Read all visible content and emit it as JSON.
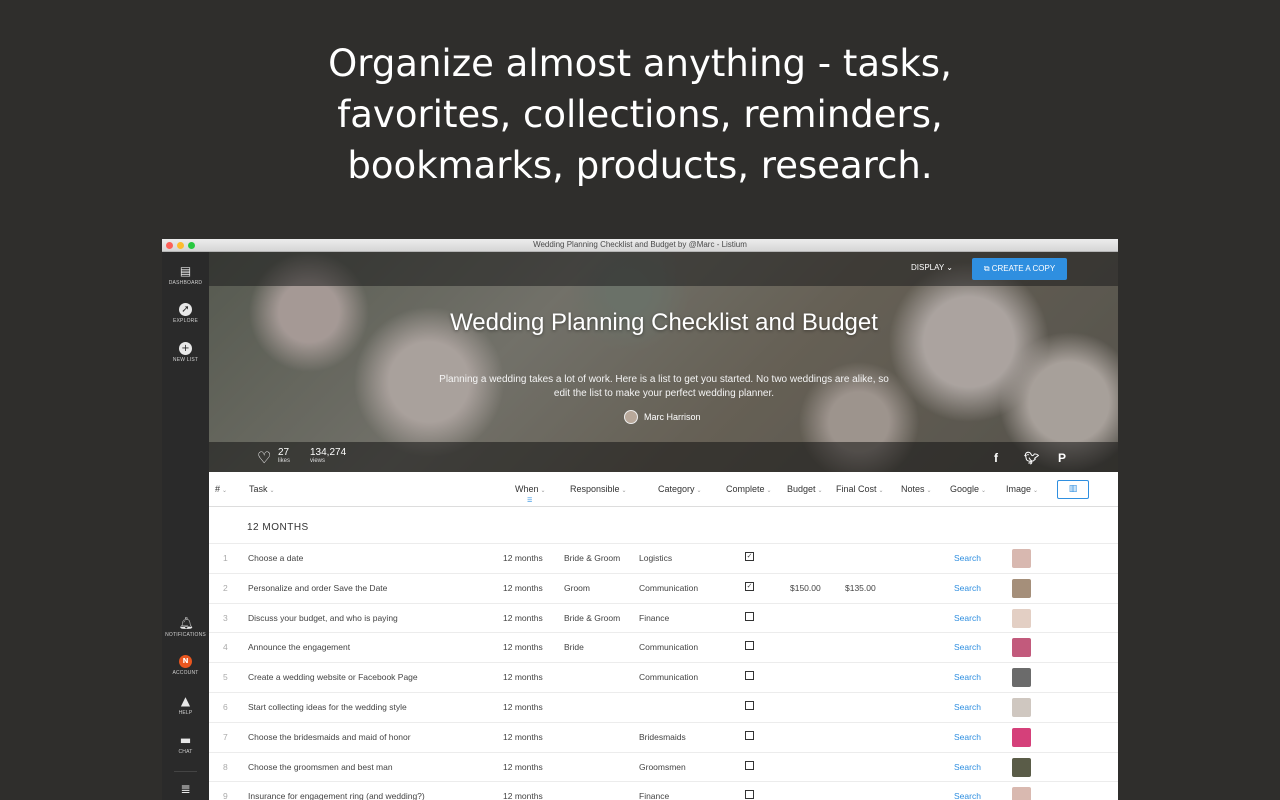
{
  "promo": {
    "line1": "Organize almost anything - tasks,",
    "line2": "favorites, collections, reminders,",
    "line3": "bookmarks, products, research."
  },
  "window": {
    "title": "Wedding Planning Checklist and Budget by @Marc - Listium"
  },
  "sidebar": {
    "dashboard": "DASHBOARD",
    "explore": "EXPLORE",
    "new_list": "NEW LIST",
    "notifications": "NOTIFICATIONS",
    "account": "ACCOUNT",
    "account_initial": "N",
    "help": "HELP",
    "chat": "CHAT"
  },
  "hero": {
    "display_label": "DISPLAY",
    "copy_label": "CREATE A COPY",
    "title": "Wedding Planning Checklist and Budget",
    "description": "Planning a wedding takes a lot of work. Here is a list to get you started. No two weddings are alike, so edit the list to make your perfect wedding planner.",
    "author": "Marc Harrison",
    "likes_count": "27",
    "likes_label": "likes",
    "views_count": "134,274",
    "views_label": "views"
  },
  "columns": [
    "#",
    "Task",
    "When",
    "Responsible",
    "Category",
    "Complete",
    "Budget",
    "Final Cost",
    "Notes",
    "Google",
    "Image"
  ],
  "group": "12 MONTHS",
  "rows": [
    {
      "num": "1",
      "task": "Choose a date",
      "when": "12 months",
      "responsible": "Bride & Groom",
      "category": "Logistics",
      "complete": true,
      "budget": "",
      "cost": "",
      "google": "Search",
      "image_color": "#d8b8b0"
    },
    {
      "num": "2",
      "task": "Personalize and order Save the Date",
      "when": "12 months",
      "responsible": "Groom",
      "category": "Communication",
      "complete": true,
      "budget": "$150.00",
      "cost": "$135.00",
      "google": "Search",
      "image_color": "#a58f7a"
    },
    {
      "num": "3",
      "task": "Discuss your budget, and who is paying",
      "when": "12 months",
      "responsible": "Bride & Groom",
      "category": "Finance",
      "complete": false,
      "budget": "",
      "cost": "",
      "google": "Search",
      "image_color": "#e3cfc4"
    },
    {
      "num": "4",
      "task": "Announce the engagement",
      "when": "12 months",
      "responsible": "Bride",
      "category": "Communication",
      "complete": false,
      "budget": "",
      "cost": "",
      "google": "Search",
      "image_color": "#c25a7c"
    },
    {
      "num": "5",
      "task": "Create a wedding website or Facebook Page",
      "when": "12 months",
      "responsible": "",
      "category": "Communication",
      "complete": false,
      "budget": "",
      "cost": "",
      "google": "Search",
      "image_color": "#6b6b6b"
    },
    {
      "num": "6",
      "task": "Start collecting ideas for the wedding style",
      "when": "12 months",
      "responsible": "",
      "category": "",
      "complete": false,
      "budget": "",
      "cost": "",
      "google": "Search",
      "image_color": "#cfc7c0"
    },
    {
      "num": "7",
      "task": "Choose the bridesmaids and maid of honor",
      "when": "12 months",
      "responsible": "",
      "category": "Bridesmaids",
      "complete": false,
      "budget": "",
      "cost": "",
      "google": "Search",
      "image_color": "#d5407a"
    },
    {
      "num": "8",
      "task": "Choose the groomsmen and best man",
      "when": "12 months",
      "responsible": "",
      "category": "Groomsmen",
      "complete": false,
      "budget": "",
      "cost": "",
      "google": "Search",
      "image_color": "#5a5c48"
    },
    {
      "num": "9",
      "task": "Insurance for engagement ring (and wedding?)",
      "when": "12 months",
      "responsible": "",
      "category": "Finance",
      "complete": false,
      "budget": "",
      "cost": "",
      "google": "Search",
      "image_color": "#d9b9b0"
    }
  ]
}
